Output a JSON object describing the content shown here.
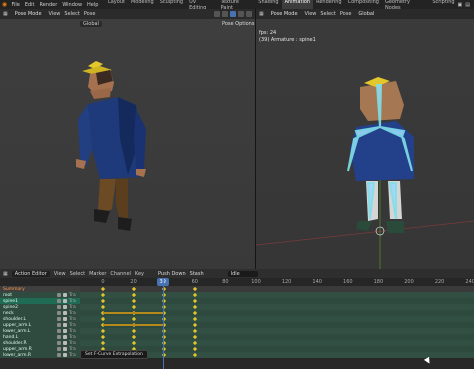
{
  "topbar": {
    "menus": [
      "File",
      "Edit",
      "Render",
      "Window",
      "Help"
    ],
    "workspaces": [
      "Layout",
      "Modeling",
      "Sculpting",
      "UV Editing",
      "Texture Paint",
      "Shading",
      "Animation",
      "Rendering",
      "Compositing",
      "Geometry Nodes",
      "Scripting"
    ],
    "active_workspace": "Animation"
  },
  "viewport_left": {
    "mode": "Pose Mode",
    "items": [
      "View",
      "Select",
      "Pose"
    ],
    "orientation": "Global",
    "options": "Pose Options"
  },
  "viewport_right": {
    "mode": "Pose Mode",
    "items": [
      "View",
      "Select",
      "Pose"
    ],
    "orientation": "Global",
    "fps": "fps: 24",
    "info": "(39) Armature : spine1"
  },
  "action_editor": {
    "mode": "Action Editor",
    "menus": [
      "View",
      "Select",
      "Marker",
      "Channel",
      "Key"
    ],
    "push_down": "Push Down",
    "stash": "Stash",
    "action_name": "Idle",
    "ruler": [
      0,
      20,
      40,
      60,
      80,
      100,
      120,
      140,
      160,
      180,
      200,
      220,
      240
    ],
    "current_frame": "39",
    "channels": [
      {
        "name": "Summary",
        "type": "summary"
      },
      {
        "name": "root",
        "type": "norm"
      },
      {
        "name": "spine1",
        "type": "sel"
      },
      {
        "name": "spine2",
        "type": "norm"
      },
      {
        "name": "neck",
        "type": "norm"
      },
      {
        "name": "shoulder.L",
        "type": "norm"
      },
      {
        "name": "upper_arm.L",
        "type": "norm"
      },
      {
        "name": "lower_arm.L",
        "type": "norm"
      },
      {
        "name": "hand.L",
        "type": "norm"
      },
      {
        "name": "shoulder.R",
        "type": "norm"
      },
      {
        "name": "upper_arm.R",
        "type": "norm"
      },
      {
        "name": "lower_arm.R",
        "type": "norm"
      }
    ],
    "channel_suffix": "Tra",
    "tooltip": "Set F-Curve Extrapolation"
  }
}
